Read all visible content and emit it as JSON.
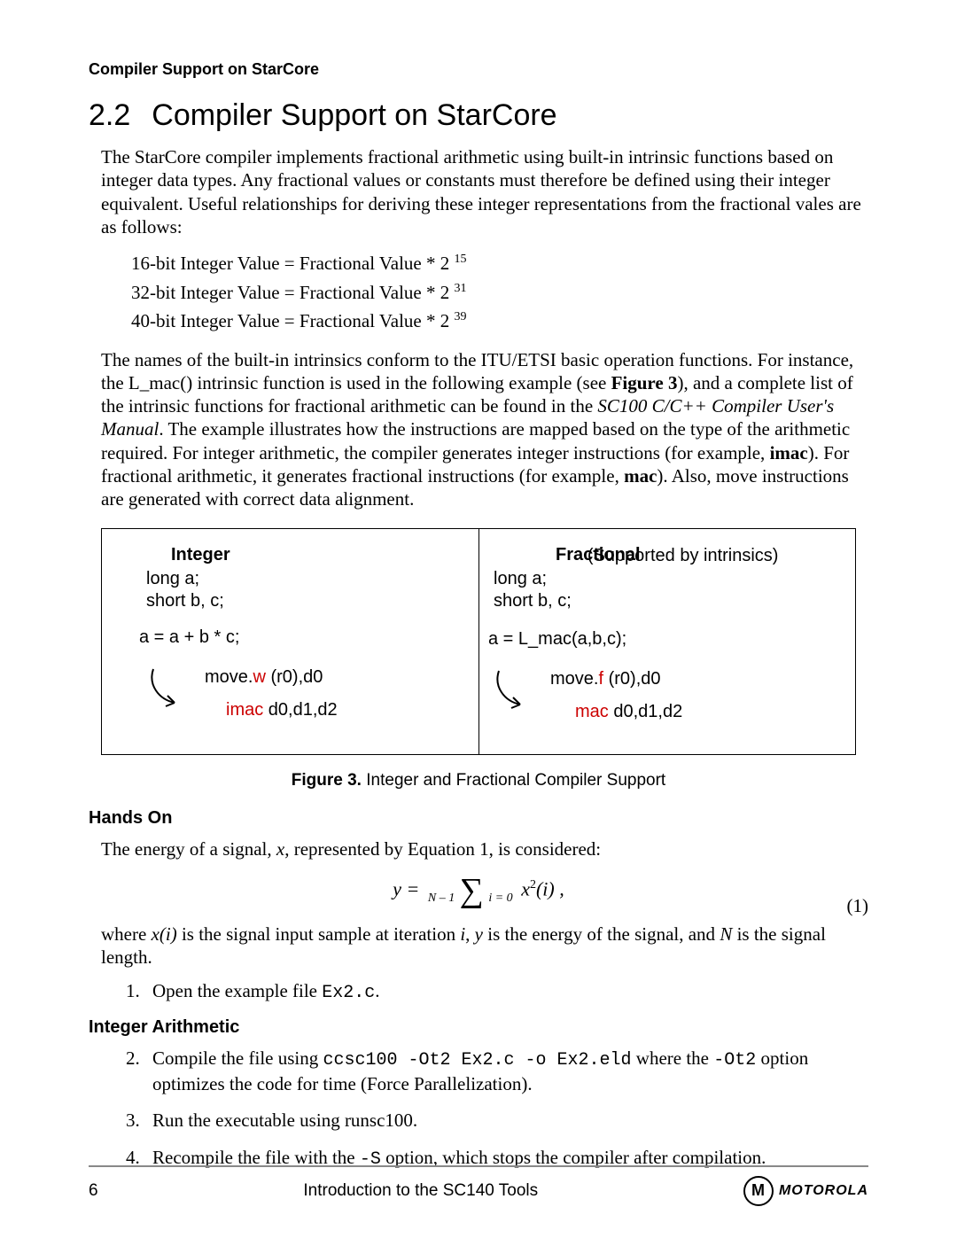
{
  "running_header": "Compiler Support on StarCore",
  "section": {
    "number": "2.2",
    "title": "Compiler Support on StarCore"
  },
  "para1": "The StarCore compiler implements fractional arithmetic using built-in intrinsic functions based on integer data types. Any fractional values or constants must therefore be defined using their integer equivalent. Useful relationships for deriving these integer representations from the fractional vales are as follows:",
  "formulas": [
    {
      "base": "16-bit Integer Value = Fractional Value * 2 ",
      "exp": "15"
    },
    {
      "base": "32-bit Integer Value = Fractional Value * 2 ",
      "exp": "31"
    },
    {
      "base": "40-bit Integer Value = Fractional Value * 2 ",
      "exp": "39"
    }
  ],
  "para2_a": "The names of the built-in intrinsics conform to the ITU/ETSI basic operation functions. For instance, the L_mac() intrinsic function is used in the following example (see ",
  "para2_b": "Figure 3",
  "para2_c": "), and a complete list of the intrinsic functions for fractional arithmetic can be found in the ",
  "para2_d": "SC100 C/C++ Compiler User's Manual",
  "para2_e": ". The example illustrates how the instructions are mapped based on the type of the arithmetic required. For integer arithmetic, the compiler generates integer instructions (for example, ",
  "para2_f": "imac",
  "para2_g": "). For fractional arithmetic, it generates fractional instructions (for example, ",
  "para2_h": "mac",
  "para2_i": "). Also, move instructions are generated with correct data alignment.",
  "figure": {
    "left": {
      "header": "Integer",
      "decl1": "long a;",
      "decl2": "short b, c;",
      "expr": "a = a + b * c;",
      "asm1_pre": "move.",
      "asm1_red": "w",
      "asm1_post": " (r0),d0",
      "asm2_red": "imac",
      "asm2_post": " d0,d1,d2"
    },
    "right": {
      "header": "Fractional",
      "subhead": "(Supported by intrinsics)",
      "decl1": "long a;",
      "decl2": "short b, c;",
      "expr": "a = L_mac(a,b,c);",
      "asm1_pre": "move.",
      "asm1_red": "f",
      "asm1_post": " (r0),d0",
      "asm2_red": "mac",
      "asm2_post": " d0,d1,d2"
    },
    "caption_bold": "Figure 3.",
    "caption_rest": "   Integer and Fractional Compiler Support"
  },
  "hands_on": "Hands On",
  "para3_a": "The energy of a signal,  ",
  "para3_b": "x",
  "para3_c": ", represented by Equation 1, is considered:",
  "equation": {
    "lhs": "y  =  ",
    "sum_top": "N – 1",
    "sum_bot": "i = 0",
    "term_x": "x",
    "term_exp": "2",
    "term_arg": "(i) ,",
    "label": "(1)"
  },
  "para4_a": "where ",
  "para4_b": "x(i)",
  "para4_c": " is the signal input sample at iteration ",
  "para4_d": "i",
  "para4_e": ", ",
  "para4_f": "y",
  "para4_g": " is the energy of the signal, and ",
  "para4_h": "N",
  "para4_i": " is the signal length.",
  "list1": {
    "num": "1.",
    "text_a": "Open the example file ",
    "text_b": "Ex2.c",
    "text_c": "."
  },
  "int_arith": "Integer Arithmetic",
  "list2": {
    "num": "2.",
    "a": "Compile the file using ",
    "b": "ccsc100 -Ot2 Ex2.c -o Ex2.eld",
    "c": " where the ",
    "d": "-Ot2",
    "e": " option optimizes the code for time (Force Parallelization)."
  },
  "list3": {
    "num": "3.",
    "text": "Run the executable using runsc100."
  },
  "list4": {
    "num": "4.",
    "a": "Recompile the file with the ",
    "b": "-S",
    "c": " option, which stops the compiler after compilation."
  },
  "footer": {
    "page": "6",
    "center": "Introduction to the SC140 Tools",
    "brand": "MOTOROLA"
  }
}
